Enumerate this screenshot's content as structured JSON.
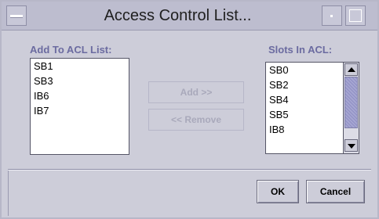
{
  "window": {
    "title": "Access Control List..."
  },
  "add_list": {
    "label": "Add To ACL List:",
    "items": [
      "SB1",
      "SB3",
      "IB6",
      "IB7"
    ]
  },
  "acl_list": {
    "label": "Slots In ACL:",
    "items": [
      "SB0",
      "SB2",
      "SB4",
      "SB5",
      "IB8"
    ]
  },
  "buttons": {
    "add": "Add >>",
    "remove": "<< Remove",
    "ok": "OK",
    "cancel": "Cancel"
  },
  "icons": {
    "window_menu": "window-menu-icon",
    "minimize": "minimize-icon",
    "maximize": "maximize-icon",
    "scroll_up": "arrow-up-icon",
    "scroll_down": "arrow-down-icon"
  },
  "colors": {
    "window_bg": "#cdcdd9",
    "label_text": "#6b6ba0",
    "scroll_thumb": "#a6a6d2"
  }
}
